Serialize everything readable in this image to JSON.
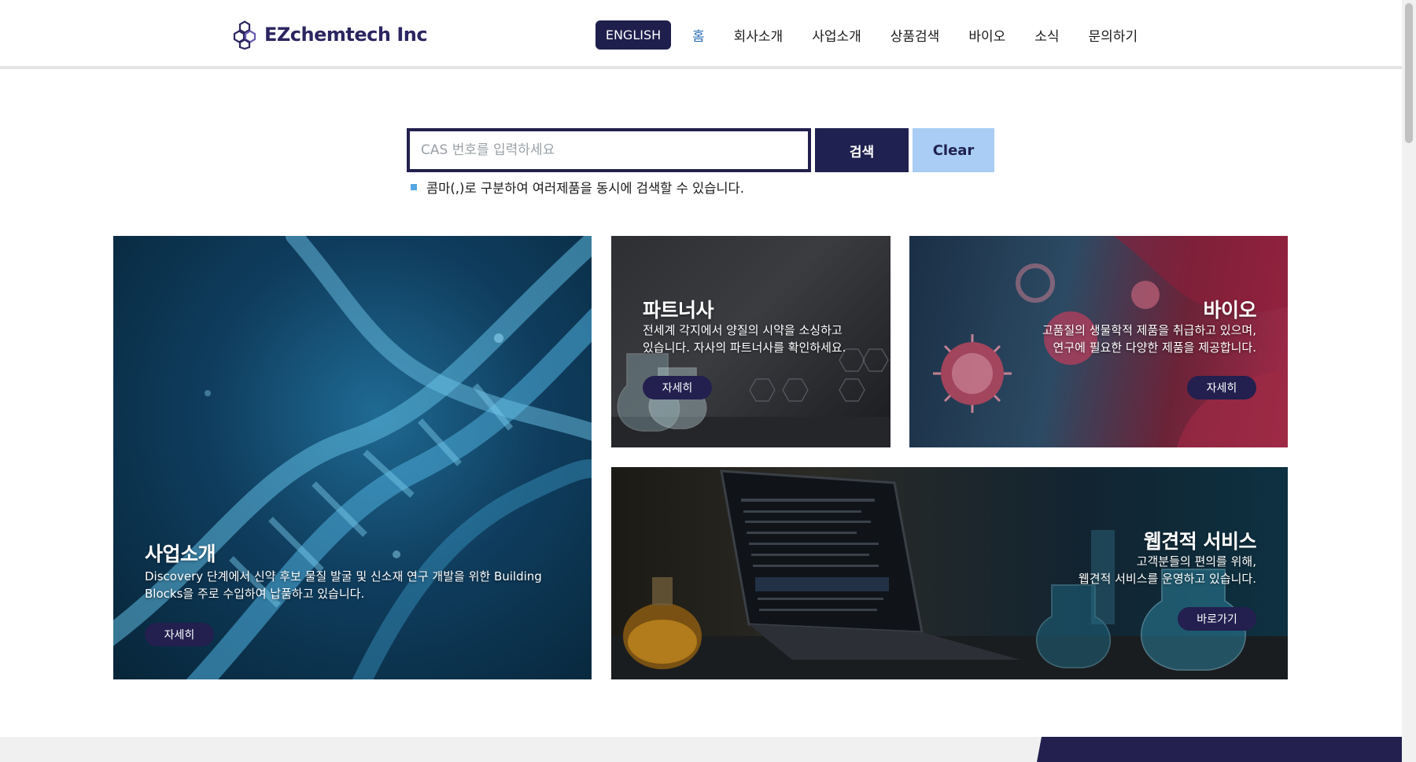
{
  "header": {
    "logo_text": "EZchemtech Inc",
    "lang_button": "ENGLISH",
    "nav": [
      {
        "label": "홈",
        "active": true
      },
      {
        "label": "회사소개"
      },
      {
        "label": "사업소개"
      },
      {
        "label": "상품검색"
      },
      {
        "label": "바이오"
      },
      {
        "label": "소식"
      },
      {
        "label": "문의하기"
      }
    ]
  },
  "search": {
    "placeholder": "CAS 번호를 입력하세요",
    "value": "",
    "search_label": "검색",
    "clear_label": "Clear",
    "hint": "콤마(,)로 구분하여 여러제품을 동시에 검색할 수 있습니다."
  },
  "cards": {
    "business": {
      "title": "사업소개",
      "desc_line1": "Discovery 단계에서 신약 후보 물질 발굴 및 신소재 연구 개발을 위한 Building",
      "desc_line2": "Blocks을 주로 수입하여 납품하고 있습니다.",
      "button": "자세히"
    },
    "partner": {
      "title": "파트너사",
      "desc_line1": "전세계 각지에서 양질의 시약을 소싱하고",
      "desc_line2": "있습니다. 자사의 파트너사를 확인하세요.",
      "button": "자세히"
    },
    "bio": {
      "title": "바이오",
      "desc_line1": "고품질의 생물학적 제품을 취급하고 있으며,",
      "desc_line2": "연구에 필요한 다양한 제품을 제공합니다.",
      "button": "자세히"
    },
    "web": {
      "title": "웹견적 서비스",
      "desc_line1": "고객분들의 편의를 위해,",
      "desc_line2": "웹견적 서비스를 운영하고 있습니다.",
      "button": "바로가기"
    }
  },
  "colors": {
    "brand_navy": "#1f2150",
    "nav_active": "#2c6fb7",
    "clear_button": "#a9cdf4",
    "hint_bullet": "#54a7e0"
  }
}
